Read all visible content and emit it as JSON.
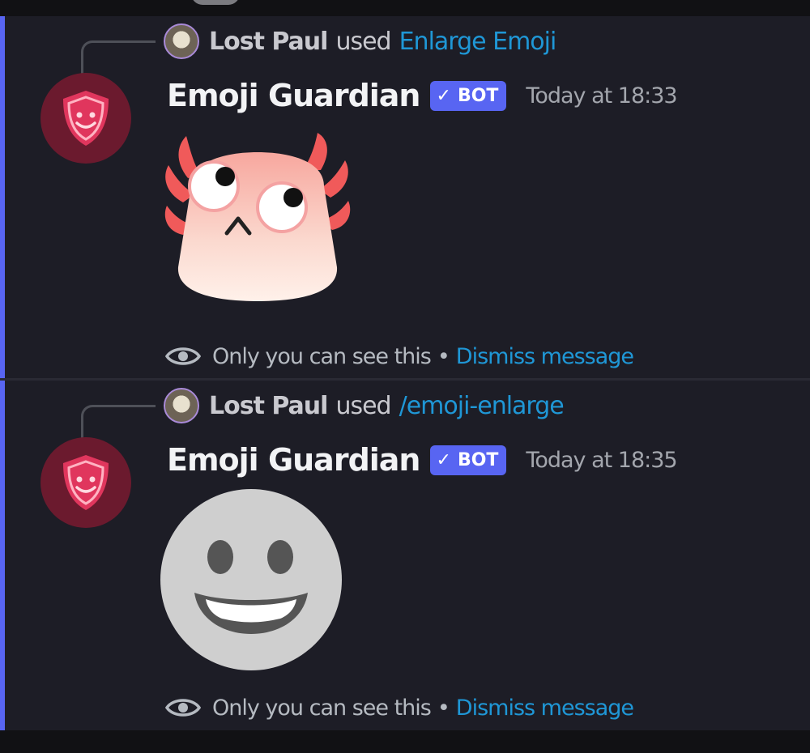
{
  "messages": [
    {
      "reply": {
        "user": "Lost Paul",
        "used_text": "used",
        "command": "Enlarge Emoji"
      },
      "author": "Emoji Guardian",
      "bot_tag": "BOT",
      "bot_check": "✓",
      "timestamp": "Today at 18:33",
      "emoji_icon": "axolotl-emoji-icon",
      "ephemeral": {
        "text": "Only you can see this",
        "separator": "•",
        "dismiss": "Dismiss message"
      }
    },
    {
      "reply": {
        "user": "Lost Paul",
        "used_text": "used",
        "command": "/emoji-enlarge"
      },
      "author": "Emoji Guardian",
      "bot_tag": "BOT",
      "bot_check": "✓",
      "timestamp": "Today at 18:35",
      "emoji_icon": "grinning-face-emoji-icon",
      "ephemeral": {
        "text": "Only you can see this",
        "separator": "•",
        "dismiss": "Dismiss message"
      }
    }
  ],
  "colors": {
    "background": "#1d1d26",
    "accent_bar": "#5865f2",
    "link": "#1f97d6",
    "avatar_bg": "#6b1a2e",
    "shield": "#e0365d"
  }
}
